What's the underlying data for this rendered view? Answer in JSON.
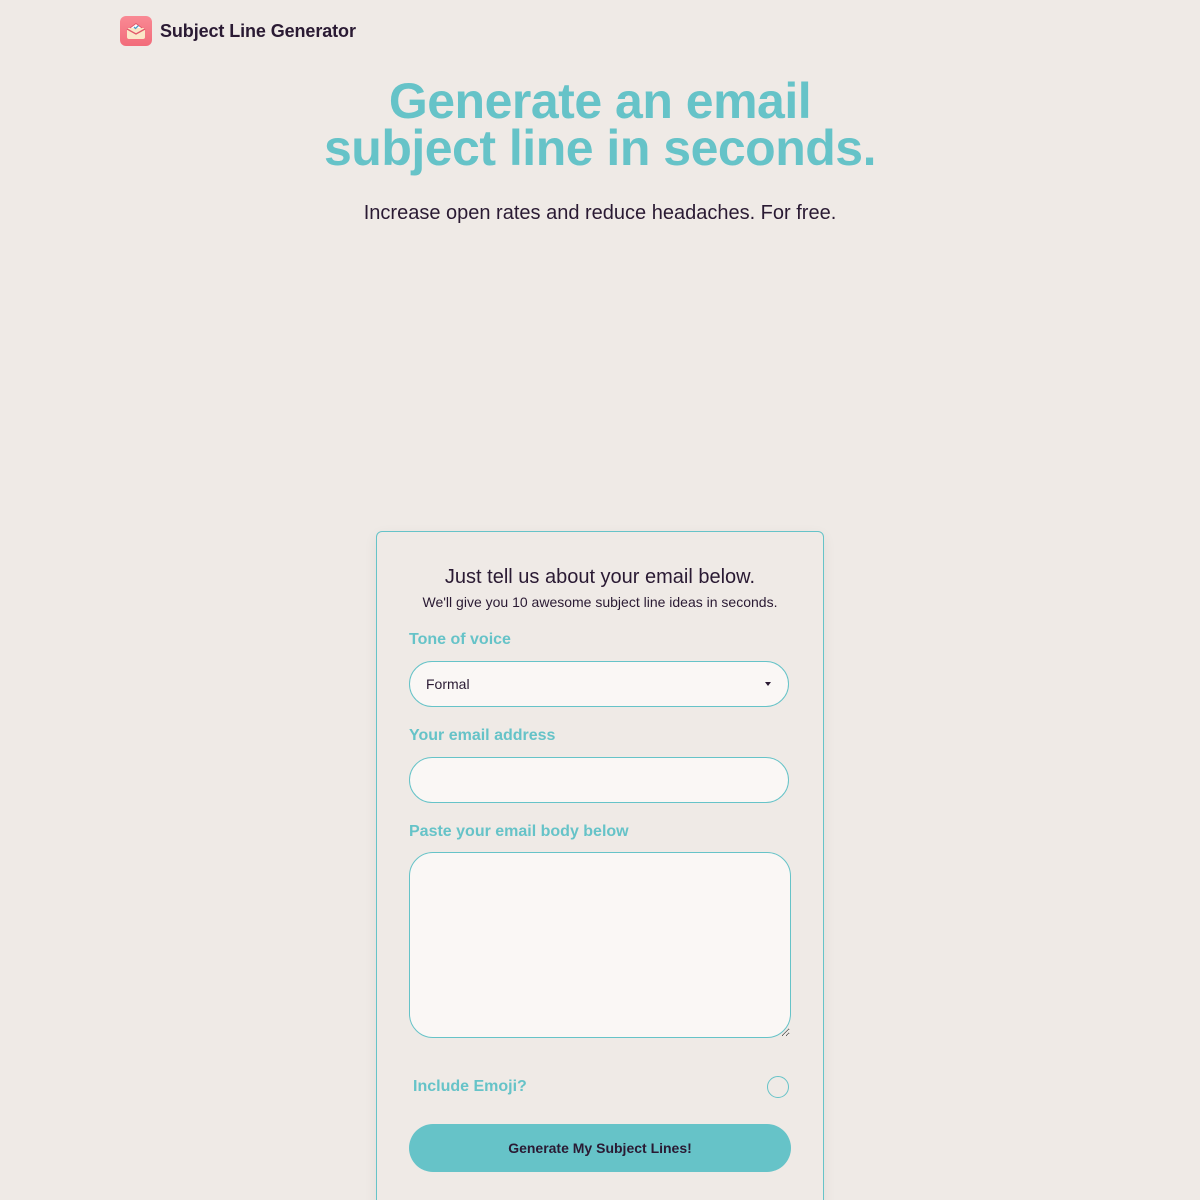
{
  "brand": {
    "name": "Subject Line Generator",
    "logo_icon": "envelope-icon"
  },
  "hero": {
    "title_line1": "Generate an email",
    "title_line2": "subject line in seconds.",
    "subtitle": "Increase open rates and reduce headaches. For free."
  },
  "form": {
    "heading": "Just tell us about your email below.",
    "subheading": "We'll give you 10 awesome subject line ideas in seconds.",
    "tone": {
      "label": "Tone of voice",
      "selected": "Formal"
    },
    "email": {
      "label": "Your email address",
      "value": ""
    },
    "body": {
      "label": "Paste your email body below",
      "value": ""
    },
    "emoji": {
      "label": "Include Emoji?",
      "checked": false
    },
    "submit_label": "Generate My Subject Lines!"
  },
  "colors": {
    "accent": "#66c3c8",
    "background": "#efeae6",
    "text": "#2a1a33",
    "logo": "#f26c7a"
  }
}
